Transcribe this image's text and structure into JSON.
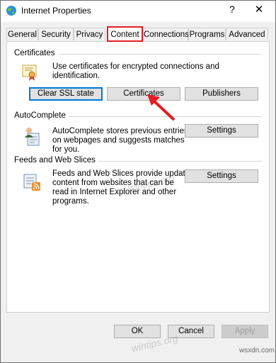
{
  "window": {
    "title": "Internet Properties",
    "help_glyph": "?",
    "close_glyph": "✕"
  },
  "tabs": [
    "General",
    "Security",
    "Privacy",
    "Content",
    "Connections",
    "Programs",
    "Advanced"
  ],
  "active_tab": "Content",
  "certificates": {
    "section_title": "Certificates",
    "description": "Use certificates for encrypted connections and identification.",
    "clear_ssl_label": "Clear SSL state",
    "certificates_label": "Certificates",
    "publishers_label": "Publishers"
  },
  "autocomplete": {
    "section_title": "AutoComplete",
    "description_line1": "AutoComplete stores previous entries",
    "description_line2": "on webpages and suggests matches",
    "description_line3": "for you.",
    "settings_label": "Settings"
  },
  "feeds": {
    "section_title": "Feeds and Web Slices",
    "description_line1": "Feeds and Web Slices provide updated",
    "description_line2": "content from websites that can be",
    "description_line3": "read in Internet Explorer and other",
    "description_line4": "programs.",
    "settings_label": "Settings"
  },
  "footer": {
    "ok_label": "OK",
    "cancel_label": "Cancel",
    "apply_label": "Apply"
  },
  "watermark": {
    "text": "wintips.org"
  },
  "corner_mark": {
    "text": "wsxdn.com"
  },
  "colors": {
    "highlight_red": "#e21d24",
    "default_button_blue": "#0078d7"
  }
}
